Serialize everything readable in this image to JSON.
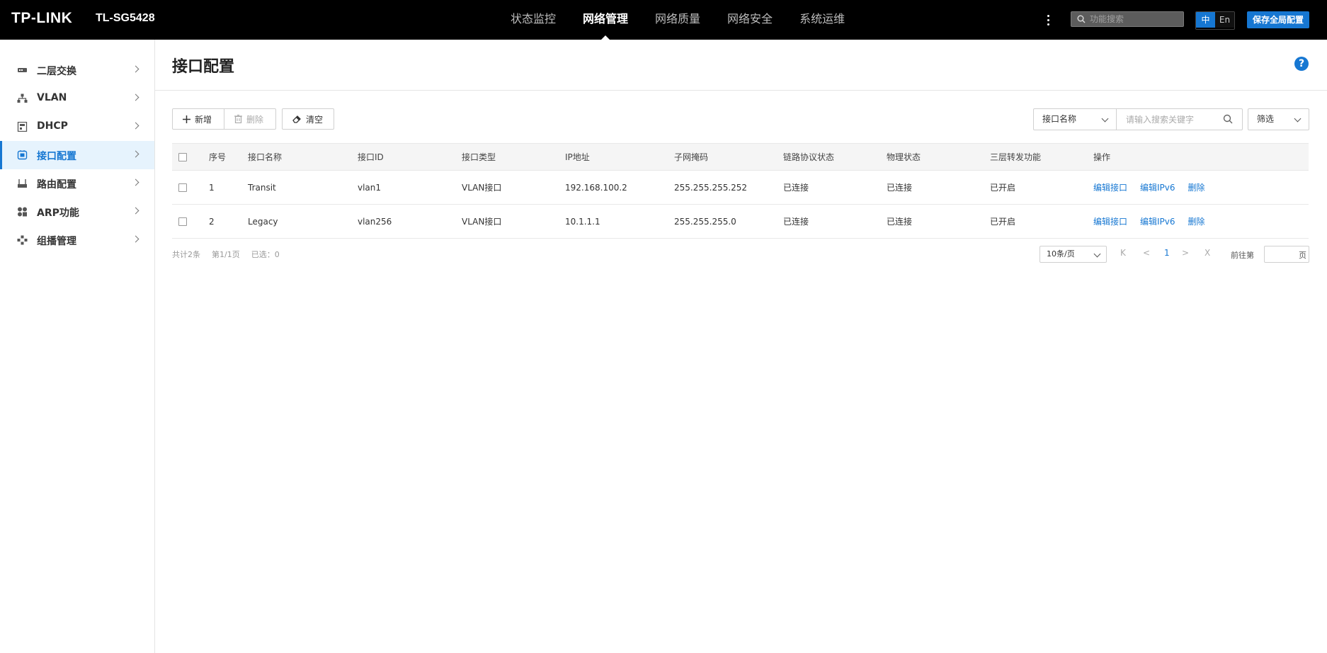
{
  "header": {
    "logo": "TP-LINK",
    "model": "TL-SG5428",
    "nav": [
      {
        "label": "状态监控",
        "active": false
      },
      {
        "label": "网络管理",
        "active": true
      },
      {
        "label": "网络质量",
        "active": false
      },
      {
        "label": "网络安全",
        "active": false
      },
      {
        "label": "系统运维",
        "active": false
      }
    ],
    "search_placeholder": "功能搜索",
    "lang_zh": "中",
    "lang_en": "En",
    "save_label": "保存全局配置"
  },
  "sidebar": {
    "items": [
      {
        "label": "二层交换",
        "icon": "switch-icon",
        "active": false
      },
      {
        "label": "VLAN",
        "icon": "vlan-icon",
        "active": false
      },
      {
        "label": "DHCP",
        "icon": "dhcp-icon",
        "active": false
      },
      {
        "label": "接口配置",
        "icon": "interface-icon",
        "active": true
      },
      {
        "label": "路由配置",
        "icon": "router-icon",
        "active": false
      },
      {
        "label": "ARP功能",
        "icon": "arp-icon",
        "active": false
      },
      {
        "label": "组播管理",
        "icon": "multicast-icon",
        "active": false
      }
    ]
  },
  "page": {
    "title": "接口配置",
    "help": "?"
  },
  "toolbar": {
    "add_label": "新增",
    "delete_label": "删除",
    "clear_label": "清空",
    "search_field": "接口名称",
    "search_placeholder": "请输入搜索关键字",
    "filter_label": "筛选"
  },
  "table": {
    "headers": [
      "序号",
      "接口名称",
      "接口ID",
      "接口类型",
      "IP地址",
      "子网掩码",
      "链路协议状态",
      "物理状态",
      "三层转发功能",
      "操作"
    ],
    "rows": [
      {
        "no": "1",
        "name": "Transit",
        "id": "vlan1",
        "type": "VLAN接口",
        "ip": "192.168.100.2",
        "mask": "255.255.255.252",
        "link": "已连接",
        "phys": "已连接",
        "l3": "已开启",
        "op_edit": "编辑接口",
        "op_ipv6": "编辑IPv6",
        "op_del": "删除"
      },
      {
        "no": "2",
        "name": "Legacy",
        "id": "vlan256",
        "type": "VLAN接口",
        "ip": "10.1.1.1",
        "mask": "255.255.255.0",
        "link": "已连接",
        "phys": "已连接",
        "l3": "已开启",
        "op_edit": "编辑接口",
        "op_ipv6": "编辑IPv6",
        "op_del": "删除"
      }
    ]
  },
  "footer": {
    "total": "共计2条",
    "pages": "第1/1页",
    "selected": "已选：0",
    "page_size": "10条/页",
    "first": "K",
    "prev": "<",
    "current_page": "1",
    "next": ">",
    "last": "X",
    "goto_label": "前往第",
    "goto_suffix": "页"
  },
  "colors": {
    "accent": "#1677d2",
    "topbar": "#000000",
    "active_bg": "#e6f3fd"
  }
}
